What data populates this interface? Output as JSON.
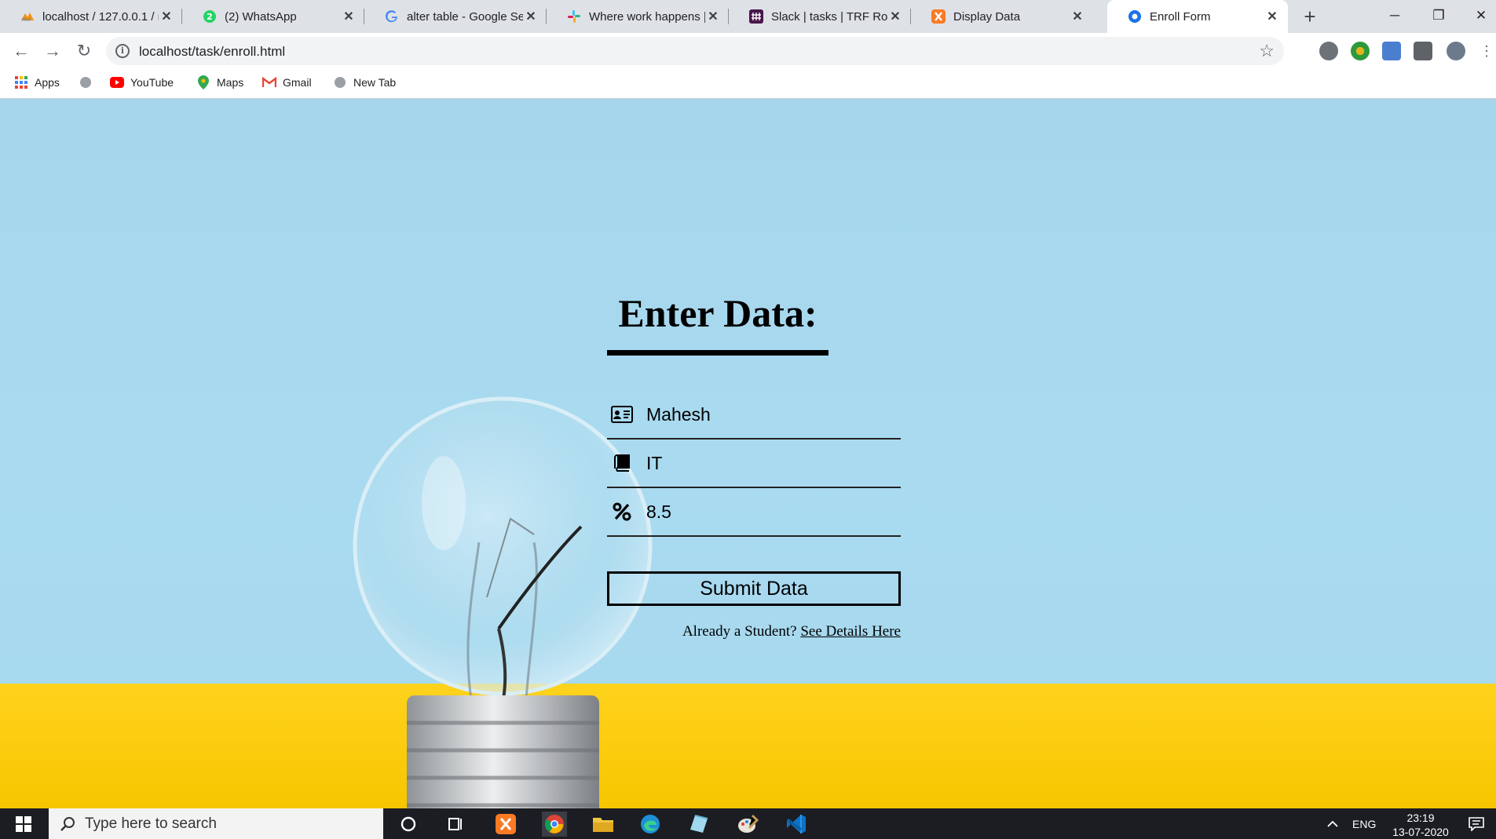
{
  "browser": {
    "tabs": [
      {
        "title": "localhost / 127.0.0.1 / m",
        "icon": "phpmyadmin-icon"
      },
      {
        "title": "(2) WhatsApp",
        "icon": "whatsapp-icon"
      },
      {
        "title": "alter table - Google Sea",
        "icon": "google-icon"
      },
      {
        "title": "Where work happens |",
        "icon": "slack-icon"
      },
      {
        "title": "Slack | tasks | TRF Robo",
        "icon": "slack-icon"
      },
      {
        "title": "Display Data",
        "icon": "xampp-icon"
      },
      {
        "title": "Enroll Form",
        "icon": "globe-icon",
        "active": true
      }
    ],
    "url": "localhost/task/enroll.html",
    "bookmarks": [
      {
        "label": "Apps",
        "icon": "apps-grid-icon"
      },
      {
        "label": "",
        "icon": "globe-icon"
      },
      {
        "label": "YouTube",
        "icon": "youtube-icon"
      },
      {
        "label": "Maps",
        "icon": "maps-pin-icon"
      },
      {
        "label": "Gmail",
        "icon": "gmail-icon"
      },
      {
        "label": "New Tab",
        "icon": "globe-icon"
      }
    ]
  },
  "page": {
    "heading": "Enter Data:",
    "fields": {
      "name": {
        "value": "Mahesh",
        "icon": "id-card-icon"
      },
      "branch": {
        "value": "IT",
        "icon": "book-icon"
      },
      "percentage": {
        "value": "8.5",
        "icon": "percent-icon"
      }
    },
    "submit_label": "Submit Data",
    "footer_prompt": "Already a Student?",
    "footer_link": "See Details Here"
  },
  "taskbar": {
    "search_placeholder": "Type here to search",
    "language": "ENG",
    "time": "23:19",
    "date": "13-07-2020"
  },
  "colors": {
    "background_blue": "#a8d9ef",
    "floor_yellow": "#ffd21c",
    "text": "#000000"
  }
}
